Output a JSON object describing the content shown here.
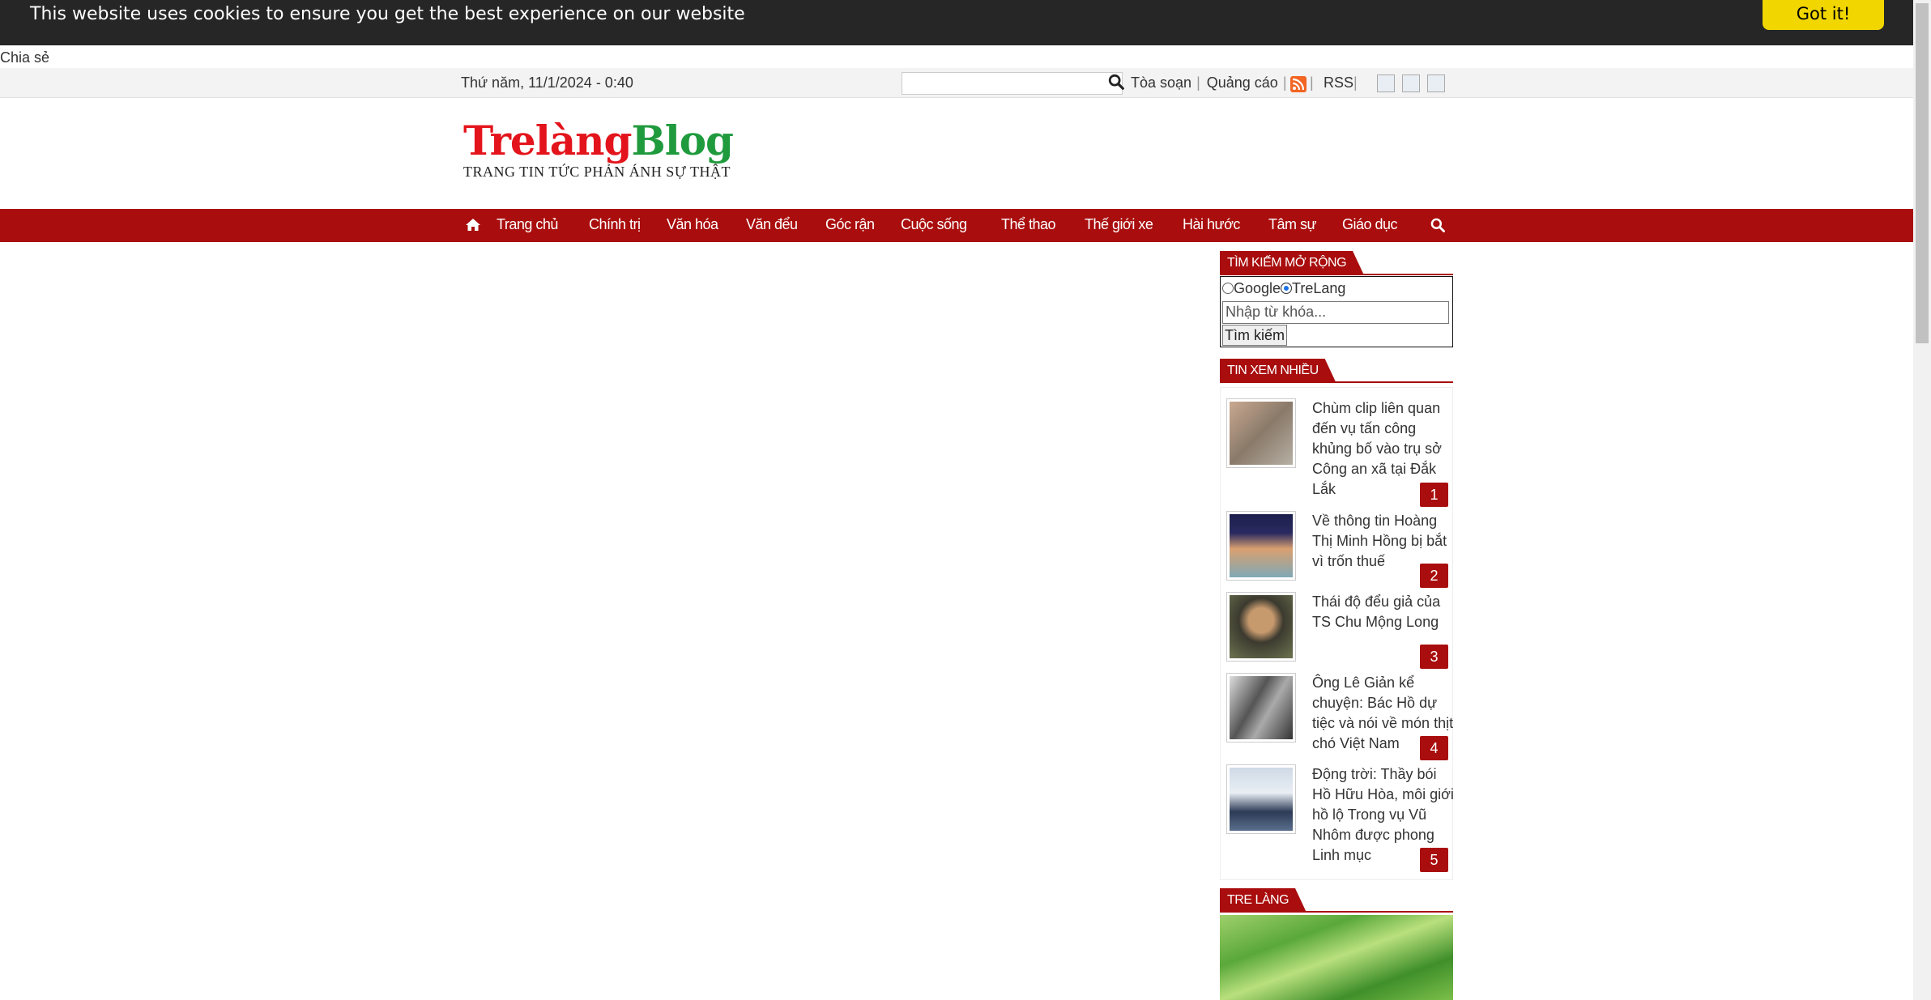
{
  "cookie": {
    "message": "This website uses cookies to ensure you get the best experience on our website",
    "button": "Got it!"
  },
  "share_label": "Chia sẻ",
  "topbar": {
    "date": "Thứ năm, 11/1/2024 - 0:40",
    "links": [
      "Tòa soạn",
      "Quảng cáo"
    ],
    "rss": "RSS"
  },
  "logo": {
    "brand_part1": "Trelàng",
    "brand_part2": "Blog",
    "tagline": "TRANG TIN TỨC PHẢN ÁNH SỰ THẬT"
  },
  "nav": {
    "items": [
      "Trang chủ",
      "Chính trị",
      "Văn hóa",
      "Văn đểu",
      "Góc rận",
      "Cuộc sống",
      "Thể thao",
      "Thế giới xe",
      "Hài hước",
      "Tâm sự",
      "Giáo dục"
    ]
  },
  "search_adv": {
    "heading": "TÌM KIẾM MỞ RỘNG",
    "option_google": "Google",
    "option_trelang": "TreLang",
    "selected": "TreLang",
    "placeholder": "Nhập từ khóa...",
    "button": "Tìm kiếm"
  },
  "popular": {
    "heading": "TIN XEM NHIỀU",
    "items": [
      {
        "rank": "1",
        "title": "Chùm clip liên quan đến vụ tấn công khủng bố vào trụ sở Công an xã tại Đắk Lắk"
      },
      {
        "rank": "2",
        "title": "Về thông tin Hoàng Thị Minh Hồng bị bắt vì trốn thuế"
      },
      {
        "rank": "3",
        "title": "Thái độ đểu giả của TS Chu Mộng Long"
      },
      {
        "rank": "4",
        "title": "Ông Lê Giản kể chuyện: Bác Hồ dự tiệc và nói về món thịt chó Việt Nam"
      },
      {
        "rank": "5",
        "title": "Động trời: Thầy bói Hồ Hữu Hòa, môi giới hồ lộ Trong vụ Vũ Nhôm được phong Linh mục"
      }
    ]
  },
  "trelang": {
    "heading": "TRE LÀNG"
  },
  "colors": {
    "brand_red": "#a90d0d",
    "cookie_bg": "#262626",
    "cookie_btn": "#f1d600"
  }
}
